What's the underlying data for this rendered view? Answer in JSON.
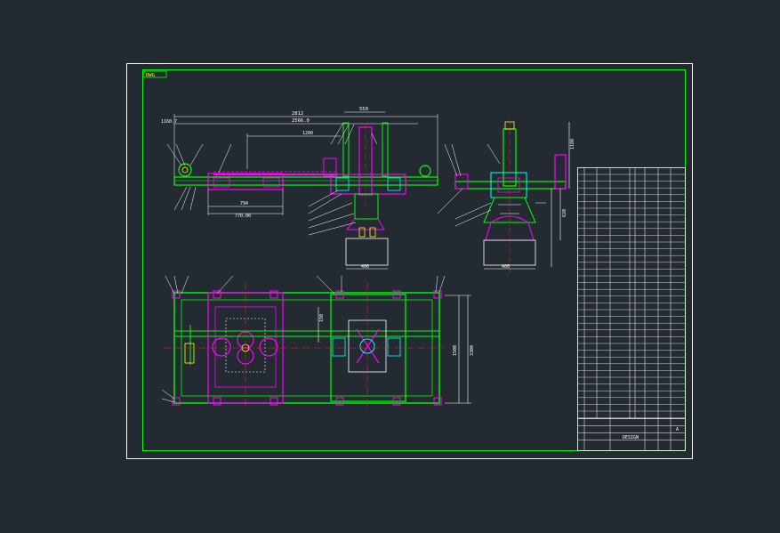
{
  "drawing": {
    "corner_tag": "DWG",
    "colors": {
      "background": "#232a31",
      "sheet_border": "#ffffff",
      "frame": "#00ff00",
      "part": "#ff00ff",
      "center_line": "#ff2020",
      "dim_line": "#ffffff",
      "accent": "#00ffff",
      "highlight": "#ffff00"
    }
  },
  "dimensions": {
    "d_2812": "2812",
    "d_2566": "2566.0",
    "d_1160_7": "1160.7",
    "d_550": "550",
    "d_1200": "1200",
    "d_794": "794",
    "d_770": "770.00",
    "d_1180": "1180",
    "d_620": "620",
    "d_400_top": "400",
    "d_1500": "1500",
    "d_3300": "3300",
    "d_150": "150",
    "d_400": "400"
  },
  "title_block": {
    "name": "DESIGN",
    "revision": "A"
  }
}
